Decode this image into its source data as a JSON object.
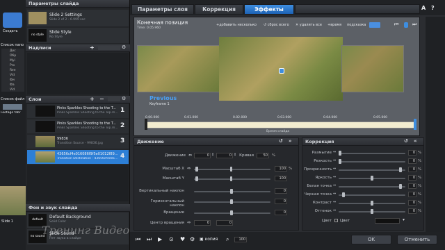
{
  "app": {
    "label": "ProShow",
    "create_label": "Создать"
  },
  "left_nav": {
    "labels": [
      "Список папо",
      "Список файл",
      "Footage fabr"
    ],
    "explorer_abbrev": [
      "Дес",
      "Обр",
      "Myi",
      "Pro",
      "Ree",
      "Vid",
      "Фи",
      "Фа",
      "Vid"
    ]
  },
  "slide_params": {
    "title": "Параметры слайда",
    "slides": [
      {
        "name": "Slide 2 Settings",
        "sub": "Slide 2 of 2 - 6.999 sec"
      },
      {
        "badge": "no style",
        "name": "Slide Style",
        "sub": "No Style"
      }
    ]
  },
  "captions": {
    "title": "Надписи"
  },
  "layers": {
    "title": "Слои",
    "items": [
      {
        "name": "Pinks Sparkles Shooting to the T...",
        "sub": "Pinks Sparkles Shooting to the Top.m...",
        "num": "1"
      },
      {
        "name": "Pinks Sparkles Shooting to the T...",
        "sub": "Pinks Sparkles Shooting to the Top.m...",
        "num": "2"
      },
      {
        "name": "99836",
        "sub": "Transition Source - 99836.jpg",
        "num": "3"
      },
      {
        "name": "43656cf4e016086f9f5e01012f89...",
        "sub": "Transition Destination - 43656cf4e01...",
        "num": "4"
      }
    ]
  },
  "bg_sound": {
    "title": "Фон и звук слайда",
    "items": [
      {
        "badge": "default",
        "name": "Default Background",
        "sub": "Solid Color"
      },
      {
        "badge": "no sound",
        "name": "Slide Sound",
        "sub": "Нет звука в слайде"
      }
    ]
  },
  "tabs": [
    "Параметры слоя",
    "Коррекция",
    "Эффекты"
  ],
  "toolbar_right": [
    "A",
    "?"
  ],
  "preview": {
    "title": "Конечная позиция",
    "time": "Time: 0.05.960",
    "buttons": {
      "add": "добавить несколько",
      "reset": "сброс всего",
      "delete": "удалить все",
      "time": "время",
      "hint": "подсказка"
    },
    "prev_label": "Previous",
    "keyframe_label": "Keyframe 1"
  },
  "timeline": {
    "ticks": [
      "0.00.000",
      "0.01.000",
      "0.02.000",
      "0.03.000",
      "0.04.000",
      "0.05.000"
    ],
    "caption": "Время слайда"
  },
  "motion": {
    "title": "Движение",
    "pan": {
      "label": "Движение",
      "x": "0",
      "y": "0"
    },
    "curve": {
      "label": "Кривая",
      "value": "50",
      "unit": "%"
    },
    "scale_x": {
      "label": "Масштаб X",
      "value": "100",
      "unit": "%"
    },
    "scale_y": {
      "label": "Масштаб Y",
      "value": "100"
    },
    "vtilt": {
      "label": "Вертикальный наклон",
      "value": "0"
    },
    "htilt": {
      "label": "Горизонтальный наклон",
      "value": "0"
    },
    "rotate": {
      "label": "Вращение",
      "value": "0"
    },
    "center": {
      "label": "Центр вращения",
      "x": "0",
      "y": "0"
    }
  },
  "correction": {
    "title": "Коррекция",
    "rows": [
      {
        "label": "Размытие",
        "value": "0",
        "unit": "%",
        "level": 0.0
      },
      {
        "label": "Резкость",
        "value": "0",
        "unit": "%",
        "level": 0.0
      },
      {
        "label": "Прозрачность",
        "value": "0",
        "unit": "%",
        "level": 0.95
      },
      {
        "label": "Яркость",
        "value": "0",
        "unit": "%",
        "level": 0.5
      },
      {
        "label": "Белая точка",
        "value": "0",
        "unit": "%",
        "level": 0.95
      },
      {
        "label": "Черная точка",
        "value": "0",
        "unit": "%",
        "level": 0.05
      },
      {
        "label": "Контраст",
        "value": "0",
        "unit": "%",
        "level": 0.5
      },
      {
        "label": "Оттенок",
        "value": "0",
        "unit": "%",
        "level": 0.5
      }
    ],
    "color_label": "Цвет",
    "color_check": "Цвет"
  },
  "bottom": {
    "copy_label": "копия",
    "zoom": "100",
    "ok": "OK",
    "cancel": "Отменить"
  },
  "watermark": "Тренинг Видео",
  "left_bottom": "Slide 1"
}
